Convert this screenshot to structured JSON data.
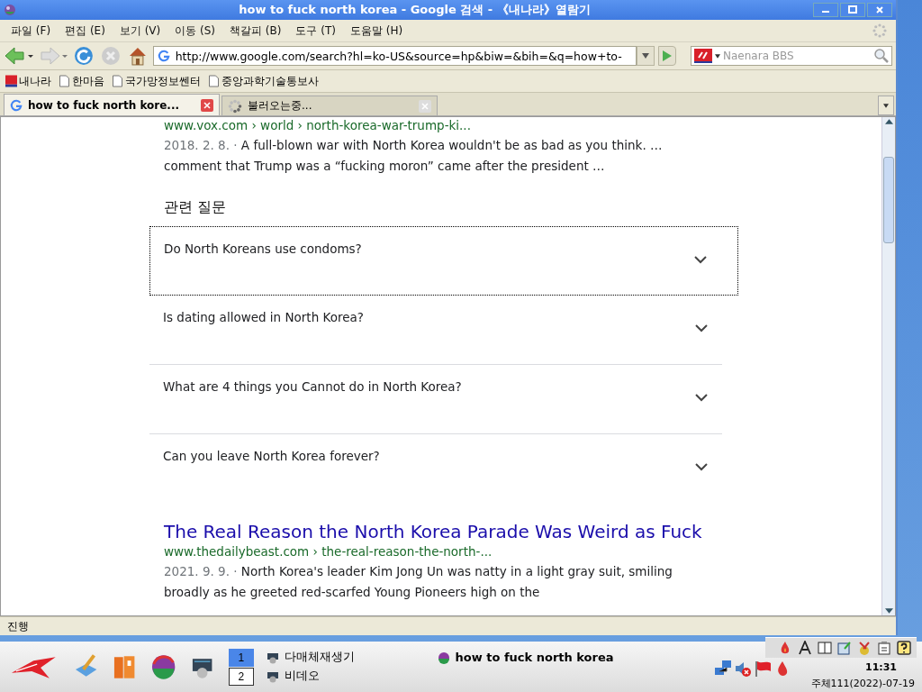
{
  "window": {
    "title": "how to fuck north korea - Google 검색 - 《내나라》열람기"
  },
  "menu": [
    "파일 (F)",
    "편집 (E)",
    "보기 (V)",
    "이동 (S)",
    "책갈피 (B)",
    "도구 (T)",
    "도움말 (H)"
  ],
  "toolbar": {
    "url": "http://www.google.com/search?hl=ko-US&source=hp&biw=&bih=&q=how+to-",
    "search_placeholder": "Naenara BBS"
  },
  "bookmarks": [
    {
      "kind": "site",
      "label": "내나라"
    },
    {
      "kind": "page",
      "label": "한마음"
    },
    {
      "kind": "page",
      "label": "국가망정보쎈터"
    },
    {
      "kind": "page",
      "label": "중앙과학기술통보사"
    }
  ],
  "tabs": [
    {
      "kind": "page",
      "label": "how to fuck north kore...",
      "selected": true
    },
    {
      "kind": "loading",
      "label": "불러오는중...",
      "selected": false
    }
  ],
  "content": {
    "prev_result": {
      "url": "www.vox.com › world › north-korea-war-trump-ki...",
      "date": "2018. 2. 8. ·",
      "snippet": "A full-blown war with North Korea wouldn't be as bad as you think. … comment that Trump was a “fucking moron” came after the president …"
    },
    "related_heading": "관련 질문",
    "questions": [
      {
        "text": "Do North Koreans use condoms?",
        "focused": true
      },
      {
        "text": "Is dating allowed in North Korea?",
        "focused": false
      },
      {
        "text": "What are 4 things you Cannot do in North Korea?",
        "focused": false
      },
      {
        "text": "Can you leave North Korea forever?",
        "focused": false
      }
    ],
    "result": {
      "title": "The Real Reason the North Korea Parade Was Weird as Fuck",
      "url": "www.thedailybeast.com › the-real-reason-the-north-...",
      "date": "2021. 9. 9. ·",
      "snippet": "North Korea's leader Kim Jong Un was natty in a light gray suit, smiling broadly as he greeted red-scarfed Young Pioneers high on the"
    }
  },
  "status_bar": "진행",
  "taskbar": {
    "workspaces": [
      {
        "label": "1",
        "selected": true
      },
      {
        "label": "2",
        "selected": false
      }
    ],
    "tasks": [
      "다매체재생기",
      "비데오"
    ],
    "active_window": "how to fuck north korea",
    "clock": "11:31",
    "date": "주체111(2022)-07-19"
  }
}
